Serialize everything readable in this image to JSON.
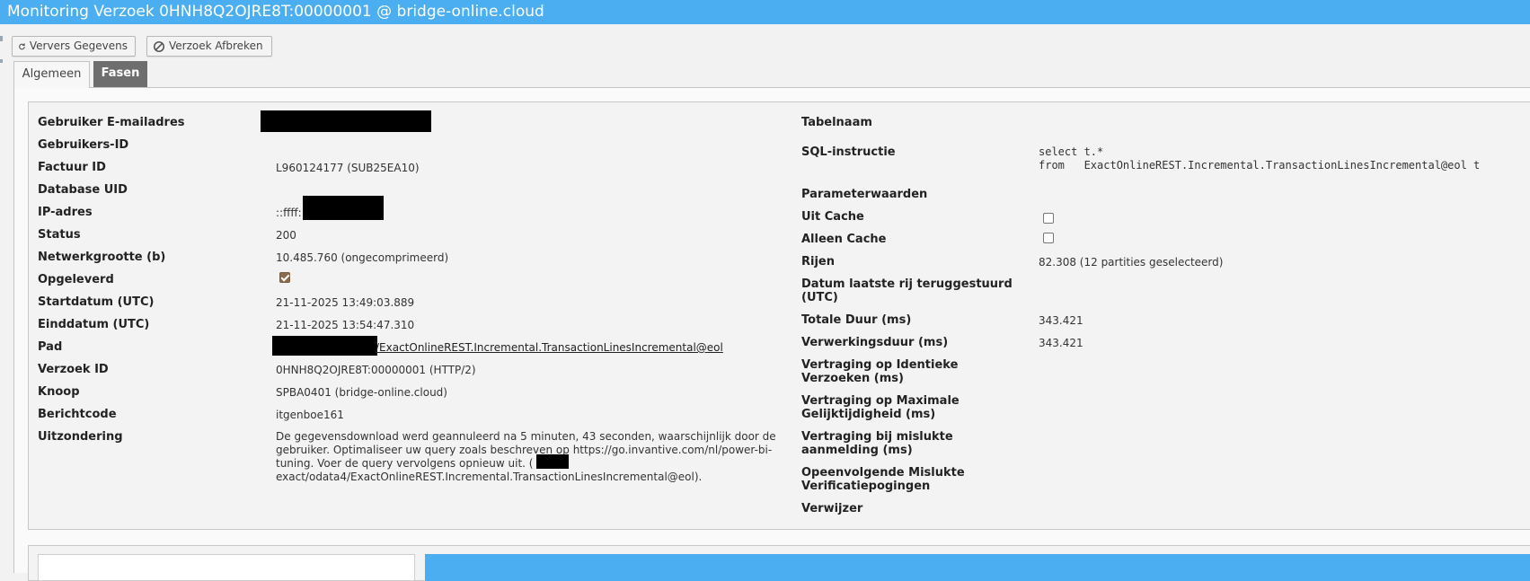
{
  "window": {
    "title": "Monitoring Verzoek 0HNH8Q2OJRE8T:00000001 @ bridge-online.cloud"
  },
  "toolbar": {
    "refresh_label": "Ververs Gegevens",
    "refresh_icon": "refresh-icon",
    "abort_label": "Verzoek Afbreken",
    "abort_icon": "ban-icon"
  },
  "tabs": [
    {
      "label": "Algemeen",
      "active": true
    },
    {
      "label": "Fasen",
      "active": false
    }
  ],
  "left": {
    "email": {
      "label": "Gebruiker E-mailadres",
      "value": ""
    },
    "user_id": {
      "label": "Gebruikers-ID",
      "value": ""
    },
    "invoice": {
      "label": "Factuur ID",
      "value": "L960124177 (SUB25EA10)"
    },
    "db_uid": {
      "label": "Database UID",
      "value": ""
    },
    "ip": {
      "label": "IP-adres",
      "value": "::ffff:"
    },
    "status": {
      "label": "Status",
      "value": "200"
    },
    "netsize": {
      "label": "Netwerkgrootte (b)",
      "value": "10.485.760 (ongecomprimeerd)"
    },
    "delivered": {
      "label": "Opgeleverd",
      "checked": true
    },
    "start": {
      "label": "Startdatum (UTC)",
      "value": "21-11-2025 13:49:03.889"
    },
    "end": {
      "label": "Einddatum (UTC)",
      "value": "21-11-2025 13:54:47.310"
    },
    "path": {
      "label": "Pad",
      "value": "/ExactOnlineREST.Incremental.TransactionLinesIncremental@eol"
    },
    "request_id": {
      "label": "Verzoek ID",
      "value": "0HNH8Q2OJRE8T:00000001 (HTTP/2)"
    },
    "node": {
      "label": "Knoop",
      "value": "SPBA0401 (bridge-online.cloud)"
    },
    "message_code": {
      "label": "Berichtcode",
      "value": "itgenboe161"
    },
    "exception": {
      "label": "Uitzondering",
      "line1": "De gegevensdownload werd geannuleerd na 5 minuten, 43 seconden, waarschijnlijk door de",
      "line2": "gebruiker. Optimaliseer uw query zoals beschreven op https://go.invantive.com/nl/power-bi-",
      "line3a": "tuning. Voer de query vervolgens opnieuw uit. (",
      "line4": "exact/odata4/ExactOnlineREST.Incremental.TransactionLinesIncremental@eol)."
    }
  },
  "right": {
    "table_name": {
      "label": "Tabelnaam",
      "value": ""
    },
    "sql": {
      "label": "SQL-instructie",
      "line1": "select t.*",
      "line2": "from   ExactOnlineREST.Incremental.TransactionLinesIncremental@eol t"
    },
    "params": {
      "label": "Parameterwaarden",
      "value": ""
    },
    "from_cache": {
      "label": "Uit Cache",
      "checked": false
    },
    "only_cache": {
      "label": "Alleen Cache",
      "checked": false
    },
    "rows": {
      "label": "Rijen",
      "value": "82.308 (12 partities geselecteerd)"
    },
    "last_row_date": {
      "label": "Datum laatste rij teruggestuurd (UTC)",
      "value": ""
    },
    "total_duration": {
      "label": "Totale Duur (ms)",
      "value": "343.421"
    },
    "processing_duration": {
      "label": "Verwerkingsduur (ms)",
      "value": "343.421"
    },
    "delay_identical": {
      "label": "Vertraging op Identieke Verzoeken (ms)",
      "value": ""
    },
    "delay_max_concurrency": {
      "label": "Vertraging op Maximale Gelijktijdigheid (ms)",
      "value": ""
    },
    "delay_failed_login": {
      "label": "Vertraging bij mislukte aanmelding (ms)",
      "value": ""
    },
    "failed_verifications": {
      "label": "Opeenvolgende Mislukte Verificatiepogingen",
      "value": ""
    },
    "referrer": {
      "label": "Verwijzer",
      "value": ""
    }
  }
}
